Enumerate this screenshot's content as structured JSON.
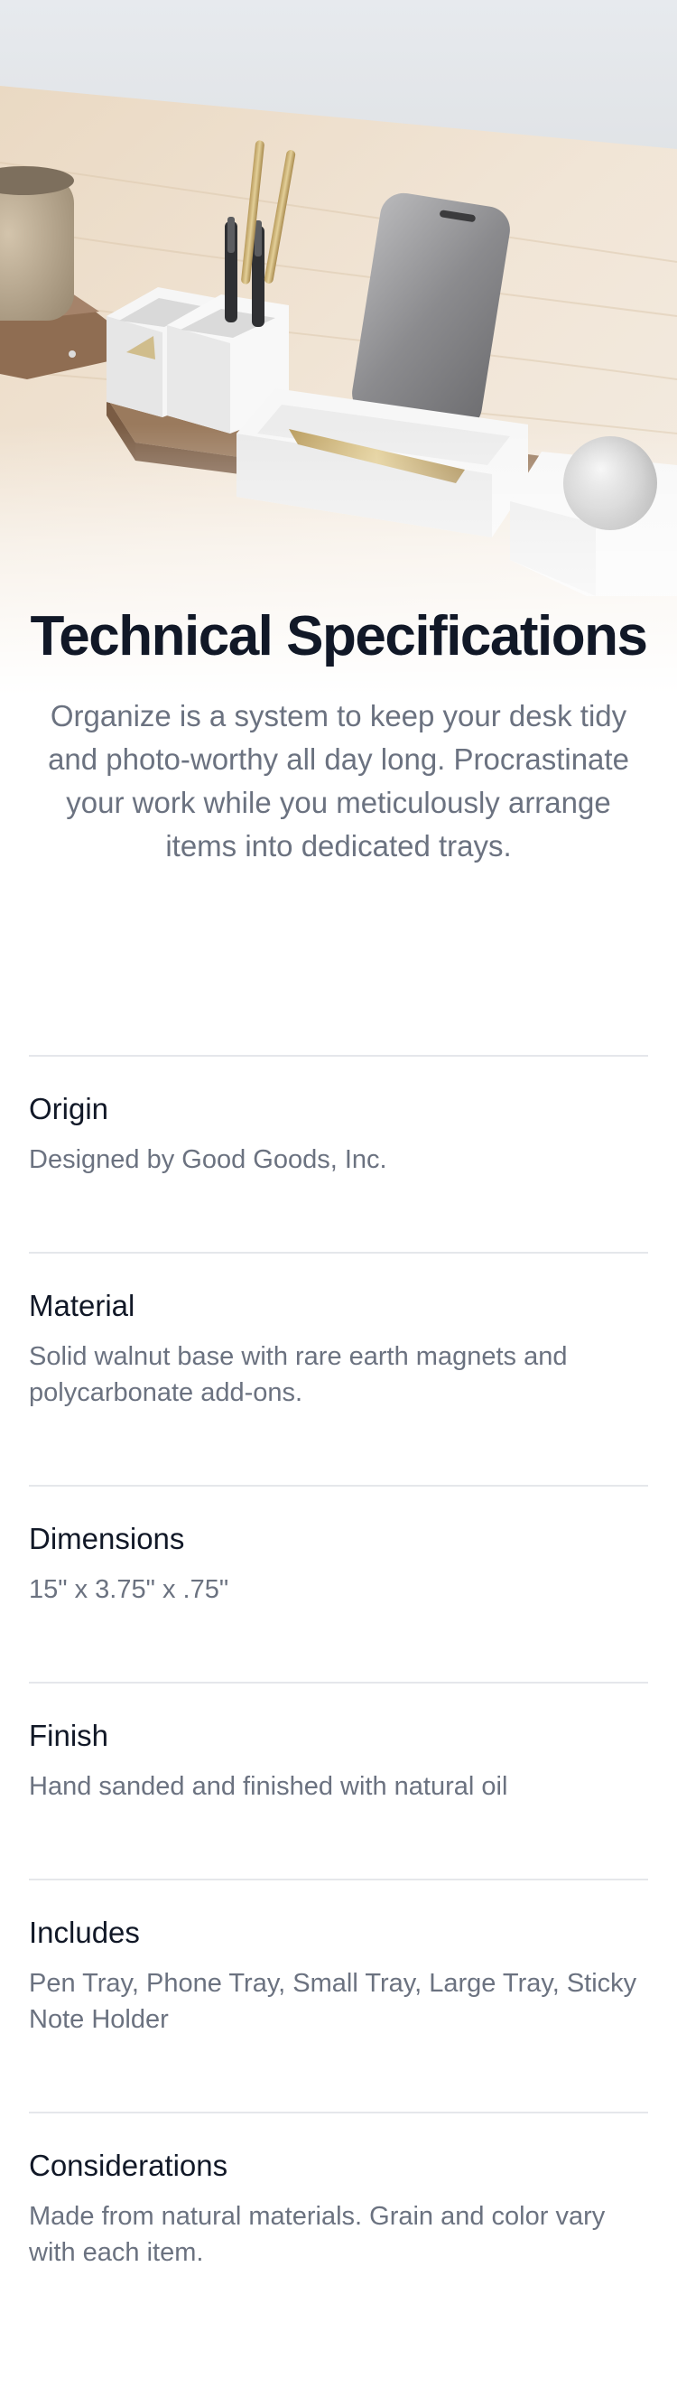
{
  "page": {
    "title": "Technical Specifications",
    "description": "Organize is a system to keep your desk tidy and photo-worthy all day long. Procrastinate your work while you meticulously arrange items into dedicated trays."
  },
  "hero": {
    "icon": "desk-organizer-photo"
  },
  "specs": [
    {
      "name": "Origin",
      "value": "Designed by Good Goods, Inc."
    },
    {
      "name": "Material",
      "value": "Solid walnut base with rare earth magnets and polycarbonate add-ons."
    },
    {
      "name": "Dimensions",
      "value": "15\" x 3.75\" x .75\""
    },
    {
      "name": "Finish",
      "value": "Hand sanded and finished with natural oil"
    },
    {
      "name": "Includes",
      "value": "Pen Tray, Phone Tray, Small Tray, Large Tray, Sticky Note Holder"
    },
    {
      "name": "Considerations",
      "value": "Made from natural materials. Grain and color vary with each item."
    }
  ],
  "colors": {
    "heading": "#111827",
    "body": "#6b7280",
    "divider": "#e5e7eb",
    "wood": "#8a6a4e",
    "desk": "#e9dccb",
    "wall": "#e6e9ec"
  }
}
